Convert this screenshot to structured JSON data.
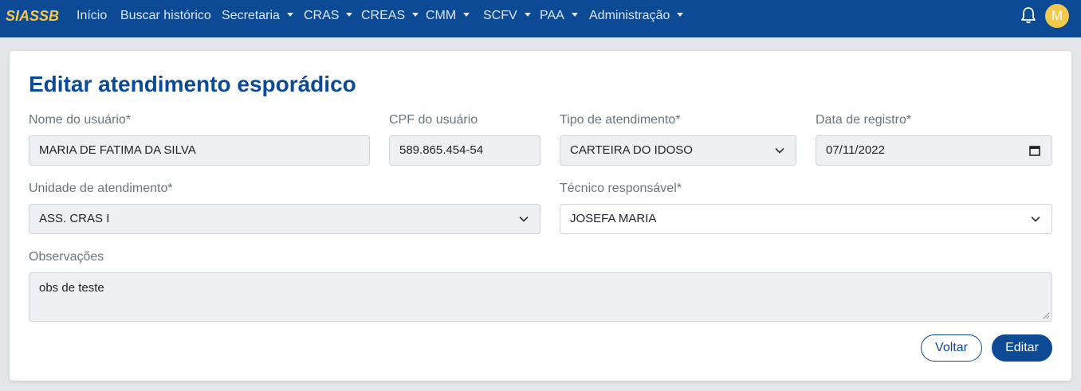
{
  "navbar": {
    "brand": "SIASSB",
    "items": [
      {
        "label": "Início"
      },
      {
        "label": "Buscar histórico"
      },
      {
        "label": "Secretaria"
      },
      {
        "label": "CRAS"
      },
      {
        "label": "CREAS"
      },
      {
        "label": "CMM"
      },
      {
        "label": "SCFV"
      },
      {
        "label": "PAA"
      },
      {
        "label": "Administração"
      }
    ],
    "avatar_initial": "M"
  },
  "form": {
    "title": "Editar atendimento esporádico",
    "nome": {
      "label": "Nome do usuário*",
      "value": "MARIA DE FATIMA DA SILVA"
    },
    "cpf": {
      "label": "CPF do usuário",
      "value": "589.865.454-54"
    },
    "tipo": {
      "label": "Tipo de atendimento*",
      "value": "CARTEIRA DO IDOSO"
    },
    "data": {
      "label": "Data de registro*",
      "value": "07/11/2022"
    },
    "unidade": {
      "label": "Unidade de atendimento*",
      "value": "ASS. CRAS I"
    },
    "tecnico": {
      "label": "Técnico responsável*",
      "value": "JOSEFA MARIA"
    },
    "observacoes": {
      "label": "Observações",
      "value": "obs de teste"
    }
  },
  "buttons": {
    "back": "Voltar",
    "submit": "Editar"
  },
  "colors": {
    "navbar": "#0d4a96",
    "brand": "#f2c94c",
    "primary": "#0d4a96"
  }
}
